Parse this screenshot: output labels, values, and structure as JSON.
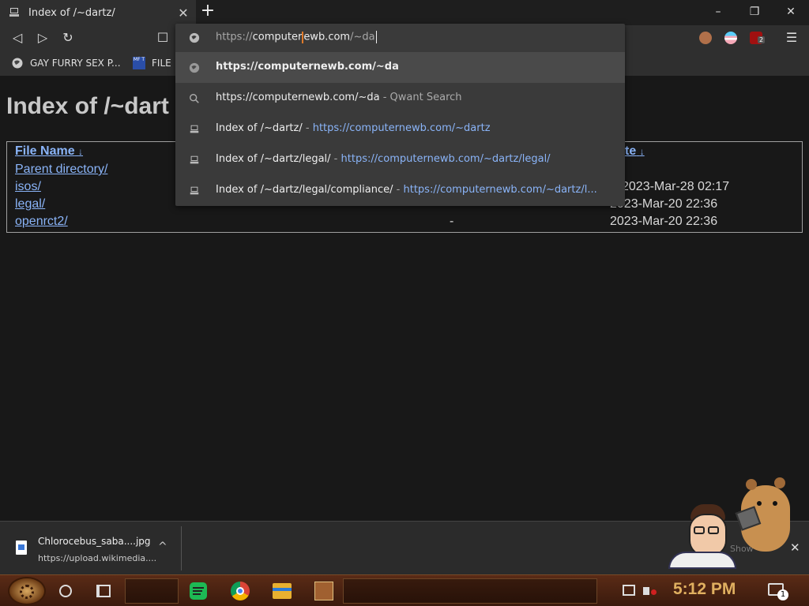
{
  "tab": {
    "title": "Index of /~dartz/",
    "close_glyph": "✕"
  },
  "new_tab_glyph": "+",
  "window_controls": {
    "minimize": "–",
    "maximize": "❐",
    "close": "✕"
  },
  "toolbar": {
    "back": "◁",
    "forward": "▷",
    "reload": "↻",
    "bookmark": "☐",
    "menu": "☰",
    "ublock_count": "2"
  },
  "bookmarks": [
    {
      "label": "GAY FURRY SEX P..."
    },
    {
      "label": "FILE"
    }
  ],
  "bookmark_badge": "MF T",
  "omnibox": {
    "scheme": "https://",
    "typed_part1": "computer",
    "typed_part2": "ewb.com",
    "typed_part3": "/~da",
    "suggestions": [
      {
        "kind": "url",
        "title": "https://computernewb.com/~da",
        "url": "",
        "selected": true
      },
      {
        "kind": "search",
        "title": "https://computernewb.com/~da",
        "provider": "Qwant Search"
      },
      {
        "kind": "page",
        "title": "Index of /~dartz/",
        "url": "https://computernewb.com/~dartz"
      },
      {
        "kind": "page",
        "title": "Index of /~dartz/legal/",
        "url": "https://computernewb.com/~dartz/legal/"
      },
      {
        "kind": "page",
        "title": "Index of /~dartz/legal/compliance/",
        "url": "https://computernewb.com/~dartz/l..."
      }
    ],
    "separator": " - "
  },
  "page": {
    "heading": "Index of /~dart",
    "columns": {
      "name": "File Name",
      "date_suffix": "te",
      "sort_glyph": "↓"
    },
    "rows": [
      {
        "name": "Parent directory/",
        "size": "",
        "date": ""
      },
      {
        "name": "isos/",
        "size": "",
        "date": "2023-Mar-28 02:17"
      },
      {
        "name": "legal/",
        "size": "",
        "date": "2023-Mar-20 22:36"
      },
      {
        "name": "openrct2/",
        "size": "-",
        "date": "2023-Mar-20 22:36"
      }
    ]
  },
  "download": {
    "filename": "Chlorocebus_saba....jpg",
    "source": "https://upload.wikimedia....",
    "chevron": "^",
    "show_all": "Show",
    "close": "✕"
  },
  "taskbar": {
    "clock": "5:12 PM",
    "notification_count": "1"
  },
  "colors": {
    "link": "#8ab4f8",
    "clock": "#e0b060",
    "caret_marker": "#e07a2a"
  }
}
